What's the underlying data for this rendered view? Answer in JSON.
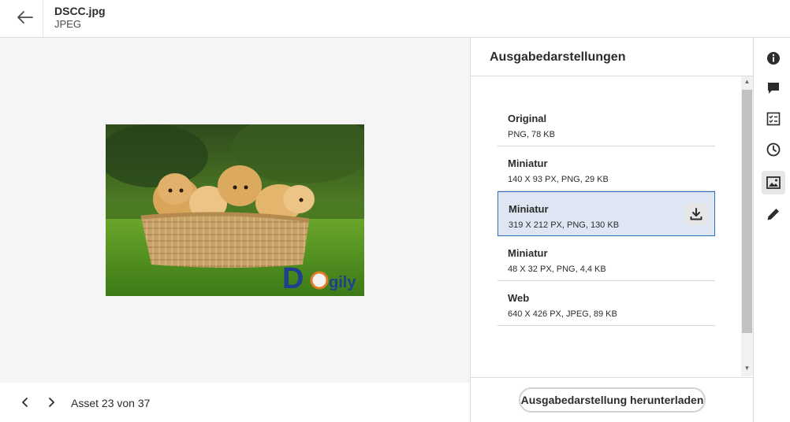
{
  "header": {
    "back_icon": "arrow-left-icon",
    "file_name": "DSCC.jpg",
    "file_type": "JPEG"
  },
  "preview": {
    "image_alt": "Puppies in a wicker basket",
    "logo_text": "Dogily"
  },
  "navigation": {
    "prev_icon": "chevron-left-icon",
    "next_icon": "chevron-right-icon",
    "counter": "Asset 23 von 37"
  },
  "panel": {
    "title": "Ausgabedarstellungen",
    "renditions": [
      {
        "name": "Original",
        "info": "PNG, 78 KB",
        "selected": false
      },
      {
        "name": "Miniatur",
        "info": "140 X 93 PX, PNG, 29 KB",
        "selected": false
      },
      {
        "name": "Miniatur",
        "info": "319 X 212 PX, PNG, 130 KB",
        "selected": true
      },
      {
        "name": "Miniatur",
        "info": "48 X 32 PX, PNG, 4,4 KB",
        "selected": false
      },
      {
        "name": "Web",
        "info": "640 X 426 PX, JPEG, 89 KB",
        "selected": false
      }
    ],
    "download_button": "Ausgabedarstellung herunterladen",
    "scroll_up": "▲",
    "scroll_down": "▼"
  },
  "rail": {
    "items": [
      {
        "icon": "info-icon",
        "active": false
      },
      {
        "icon": "comment-icon",
        "active": false
      },
      {
        "icon": "checklist-icon",
        "active": false
      },
      {
        "icon": "clock-icon",
        "active": false
      },
      {
        "icon": "image-icon",
        "active": true
      },
      {
        "icon": "pencil-icon",
        "active": false
      }
    ]
  },
  "colors": {
    "selected_bg": "#dde6f2",
    "selected_border": "#2f6fc1",
    "preview_bg": "#f5f5f5"
  }
}
